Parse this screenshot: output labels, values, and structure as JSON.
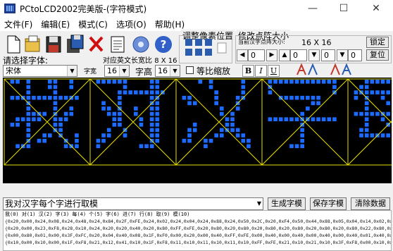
{
  "window": {
    "title": "PCtoLCD2002完美版-(字符模式)",
    "minimize": "—",
    "maximize": "☐",
    "close": "✕"
  },
  "menu": [
    "文件(F)",
    "编辑(E)",
    "模式(C)",
    "选项(O)",
    "帮助(H)"
  ],
  "toolbar": {
    "icons": [
      "new-file-icon",
      "open-file-icon",
      "save-icon",
      "save-as-icon",
      "delete-icon",
      "clipboard-icon",
      "settings-gear-icon",
      "help-icon"
    ],
    "font_label": "请选择字体:",
    "ascii_label": "对应英文长宽比",
    "ascii_value": "8 X 16",
    "font_value": "宋体",
    "width_label": "字宽",
    "width_value": "16",
    "height_label": "字高",
    "height_value": "16",
    "proportional_label": "等比缩放",
    "bold": "B",
    "italic": "I",
    "underline": "U"
  },
  "pixel_adjust": {
    "title": "调整像素位置"
  },
  "dot_matrix": {
    "title": "修改点阵大小",
    "current_label": "当前汉字点阵大小:",
    "current_value": "16 X 16",
    "w_value": "0",
    "h_value": "0",
    "w2_value": "0",
    "h2_value": "0",
    "lock_button": "锁定",
    "reset_button": "复位"
  },
  "preview": {
    "chars": [
      "我",
      "对",
      "汉",
      "字",
      "每"
    ],
    "pixel_color": "#1e6cff",
    "grid_color": "#e8e000"
  },
  "input": {
    "text": "我对汉字每个字进行取模",
    "generate_button": "生成字模",
    "save_button": "保存字模",
    "clear_button": "清除数据"
  },
  "output": {
    "header": "我(0) 对(1) 汉(2) 字(3) 每(4) 个(5) 字(6) 进(7) 行(8) 取(9) 模(10)",
    "lines": [
      "{0x20,0x00,0x24,0x08,0x24,0x48,0x24,0x84,0x2F,0xFE,0x24,0x02,0x24,0x04,0x24,0x88,0x24,0x50,0x2C,0x20,0xF4,0x50,0x44,0x88,0x05,0x04,0x14,0x02,0x08,0x02,0x00,0x00},",
      "{0x20,0x00,0x23,0xF8,0x28,0x10,0x24,0x20,0x20,0x40,0x20,0x80,0xFF,0xFE,0x20,0x80,0x20,0x80,0x20,0x80,0x20,0x80,0x20,0x80,0x20,0x80,0x22,0x80,0x21,0x00,0x00,0x00},",
      "{0x00,0x80,0x01,0x00,0x3F,0xFC,0x20,0x04,0x40,0x08,0x1F,0xF0,0x00,0x20,0x00,0x40,0xFF,0xFE,0x00,0x40,0x00,0x40,0x00,0x40,0x00,0x40,0x01,0x40,0x00,0x80,0x00,0x00},",
      "{0x10,0x00,0x10,0x00,0x1F,0xF8,0x21,0x12,0x41,0x10,0x1F,0xF8,0x11,0x10,0x11,0x10,0x11,0x10,0xFF,0xFE,0x21,0x10,0x21,0x10,0x3F,0xF8,0x00,0x10,0x00,0xA0,0x00,0x40}"
    ]
  }
}
